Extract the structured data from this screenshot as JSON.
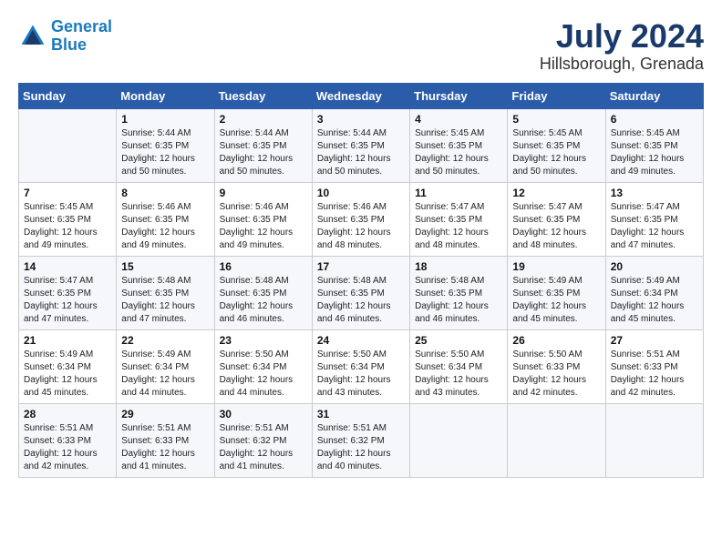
{
  "header": {
    "logo_line1": "General",
    "logo_line2": "Blue",
    "month_year": "July 2024",
    "location": "Hillsborough, Grenada"
  },
  "calendar": {
    "days_of_week": [
      "Sunday",
      "Monday",
      "Tuesday",
      "Wednesday",
      "Thursday",
      "Friday",
      "Saturday"
    ],
    "weeks": [
      [
        {
          "day": "",
          "info": ""
        },
        {
          "day": "1",
          "info": "Sunrise: 5:44 AM\nSunset: 6:35 PM\nDaylight: 12 hours\nand 50 minutes."
        },
        {
          "day": "2",
          "info": "Sunrise: 5:44 AM\nSunset: 6:35 PM\nDaylight: 12 hours\nand 50 minutes."
        },
        {
          "day": "3",
          "info": "Sunrise: 5:44 AM\nSunset: 6:35 PM\nDaylight: 12 hours\nand 50 minutes."
        },
        {
          "day": "4",
          "info": "Sunrise: 5:45 AM\nSunset: 6:35 PM\nDaylight: 12 hours\nand 50 minutes."
        },
        {
          "day": "5",
          "info": "Sunrise: 5:45 AM\nSunset: 6:35 PM\nDaylight: 12 hours\nand 50 minutes."
        },
        {
          "day": "6",
          "info": "Sunrise: 5:45 AM\nSunset: 6:35 PM\nDaylight: 12 hours\nand 49 minutes."
        }
      ],
      [
        {
          "day": "7",
          "info": "Sunrise: 5:45 AM\nSunset: 6:35 PM\nDaylight: 12 hours\nand 49 minutes."
        },
        {
          "day": "8",
          "info": "Sunrise: 5:46 AM\nSunset: 6:35 PM\nDaylight: 12 hours\nand 49 minutes."
        },
        {
          "day": "9",
          "info": "Sunrise: 5:46 AM\nSunset: 6:35 PM\nDaylight: 12 hours\nand 49 minutes."
        },
        {
          "day": "10",
          "info": "Sunrise: 5:46 AM\nSunset: 6:35 PM\nDaylight: 12 hours\nand 48 minutes."
        },
        {
          "day": "11",
          "info": "Sunrise: 5:47 AM\nSunset: 6:35 PM\nDaylight: 12 hours\nand 48 minutes."
        },
        {
          "day": "12",
          "info": "Sunrise: 5:47 AM\nSunset: 6:35 PM\nDaylight: 12 hours\nand 48 minutes."
        },
        {
          "day": "13",
          "info": "Sunrise: 5:47 AM\nSunset: 6:35 PM\nDaylight: 12 hours\nand 47 minutes."
        }
      ],
      [
        {
          "day": "14",
          "info": "Sunrise: 5:47 AM\nSunset: 6:35 PM\nDaylight: 12 hours\nand 47 minutes."
        },
        {
          "day": "15",
          "info": "Sunrise: 5:48 AM\nSunset: 6:35 PM\nDaylight: 12 hours\nand 47 minutes."
        },
        {
          "day": "16",
          "info": "Sunrise: 5:48 AM\nSunset: 6:35 PM\nDaylight: 12 hours\nand 46 minutes."
        },
        {
          "day": "17",
          "info": "Sunrise: 5:48 AM\nSunset: 6:35 PM\nDaylight: 12 hours\nand 46 minutes."
        },
        {
          "day": "18",
          "info": "Sunrise: 5:48 AM\nSunset: 6:35 PM\nDaylight: 12 hours\nand 46 minutes."
        },
        {
          "day": "19",
          "info": "Sunrise: 5:49 AM\nSunset: 6:35 PM\nDaylight: 12 hours\nand 45 minutes."
        },
        {
          "day": "20",
          "info": "Sunrise: 5:49 AM\nSunset: 6:34 PM\nDaylight: 12 hours\nand 45 minutes."
        }
      ],
      [
        {
          "day": "21",
          "info": "Sunrise: 5:49 AM\nSunset: 6:34 PM\nDaylight: 12 hours\nand 45 minutes."
        },
        {
          "day": "22",
          "info": "Sunrise: 5:49 AM\nSunset: 6:34 PM\nDaylight: 12 hours\nand 44 minutes."
        },
        {
          "day": "23",
          "info": "Sunrise: 5:50 AM\nSunset: 6:34 PM\nDaylight: 12 hours\nand 44 minutes."
        },
        {
          "day": "24",
          "info": "Sunrise: 5:50 AM\nSunset: 6:34 PM\nDaylight: 12 hours\nand 43 minutes."
        },
        {
          "day": "25",
          "info": "Sunrise: 5:50 AM\nSunset: 6:34 PM\nDaylight: 12 hours\nand 43 minutes."
        },
        {
          "day": "26",
          "info": "Sunrise: 5:50 AM\nSunset: 6:33 PM\nDaylight: 12 hours\nand 42 minutes."
        },
        {
          "day": "27",
          "info": "Sunrise: 5:51 AM\nSunset: 6:33 PM\nDaylight: 12 hours\nand 42 minutes."
        }
      ],
      [
        {
          "day": "28",
          "info": "Sunrise: 5:51 AM\nSunset: 6:33 PM\nDaylight: 12 hours\nand 42 minutes."
        },
        {
          "day": "29",
          "info": "Sunrise: 5:51 AM\nSunset: 6:33 PM\nDaylight: 12 hours\nand 41 minutes."
        },
        {
          "day": "30",
          "info": "Sunrise: 5:51 AM\nSunset: 6:32 PM\nDaylight: 12 hours\nand 41 minutes."
        },
        {
          "day": "31",
          "info": "Sunrise: 5:51 AM\nSunset: 6:32 PM\nDaylight: 12 hours\nand 40 minutes."
        },
        {
          "day": "",
          "info": ""
        },
        {
          "day": "",
          "info": ""
        },
        {
          "day": "",
          "info": ""
        }
      ]
    ]
  }
}
